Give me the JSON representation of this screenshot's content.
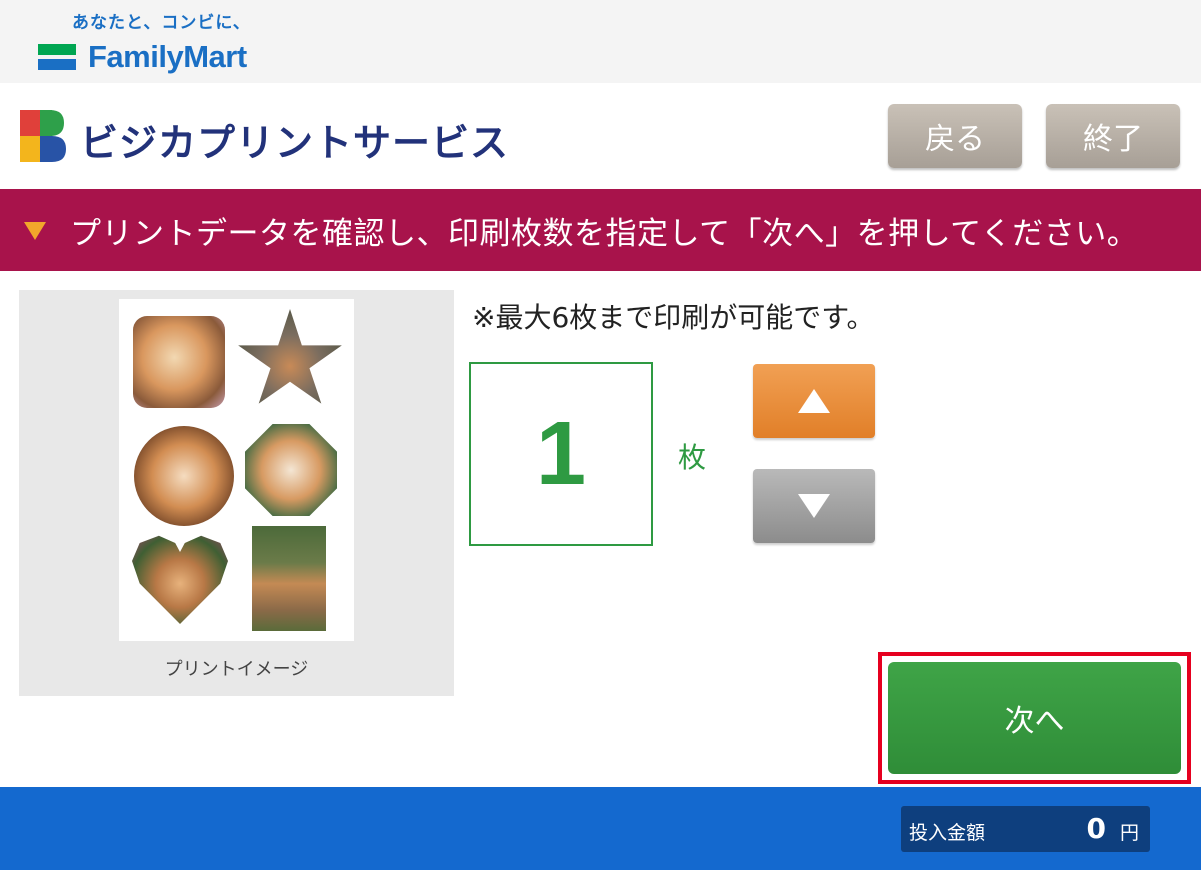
{
  "header": {
    "tagline": "あなたと、コンビに、",
    "brand": "FamilyMart"
  },
  "title": {
    "service_name": "ビジカプリントサービス",
    "back_label": "戻る",
    "end_label": "終了"
  },
  "banner": {
    "text": "プリントデータを確認し、印刷枚数を指定して「次へ」を押してください。"
  },
  "preview": {
    "caption": "プリントイメージ"
  },
  "copies": {
    "max_note": "※最大6枚まで印刷が可能です。",
    "count": "1",
    "unit": "枚"
  },
  "actions": {
    "next_label": "次へ"
  },
  "footer": {
    "amount_label": "投入金額",
    "amount_value": "0",
    "amount_unit": "円"
  },
  "icons": {
    "banner": "triangle-down-icon",
    "increment": "triangle-up-icon",
    "decrement": "triangle-down-icon"
  },
  "colors": {
    "brand_blue": "#1a6fc4",
    "banner_red": "#a8134b",
    "accent_green": "#2e9a42",
    "increment_orange": "#e17f28",
    "highlight_red": "#e6001f",
    "footer_blue": "#1469cf"
  }
}
